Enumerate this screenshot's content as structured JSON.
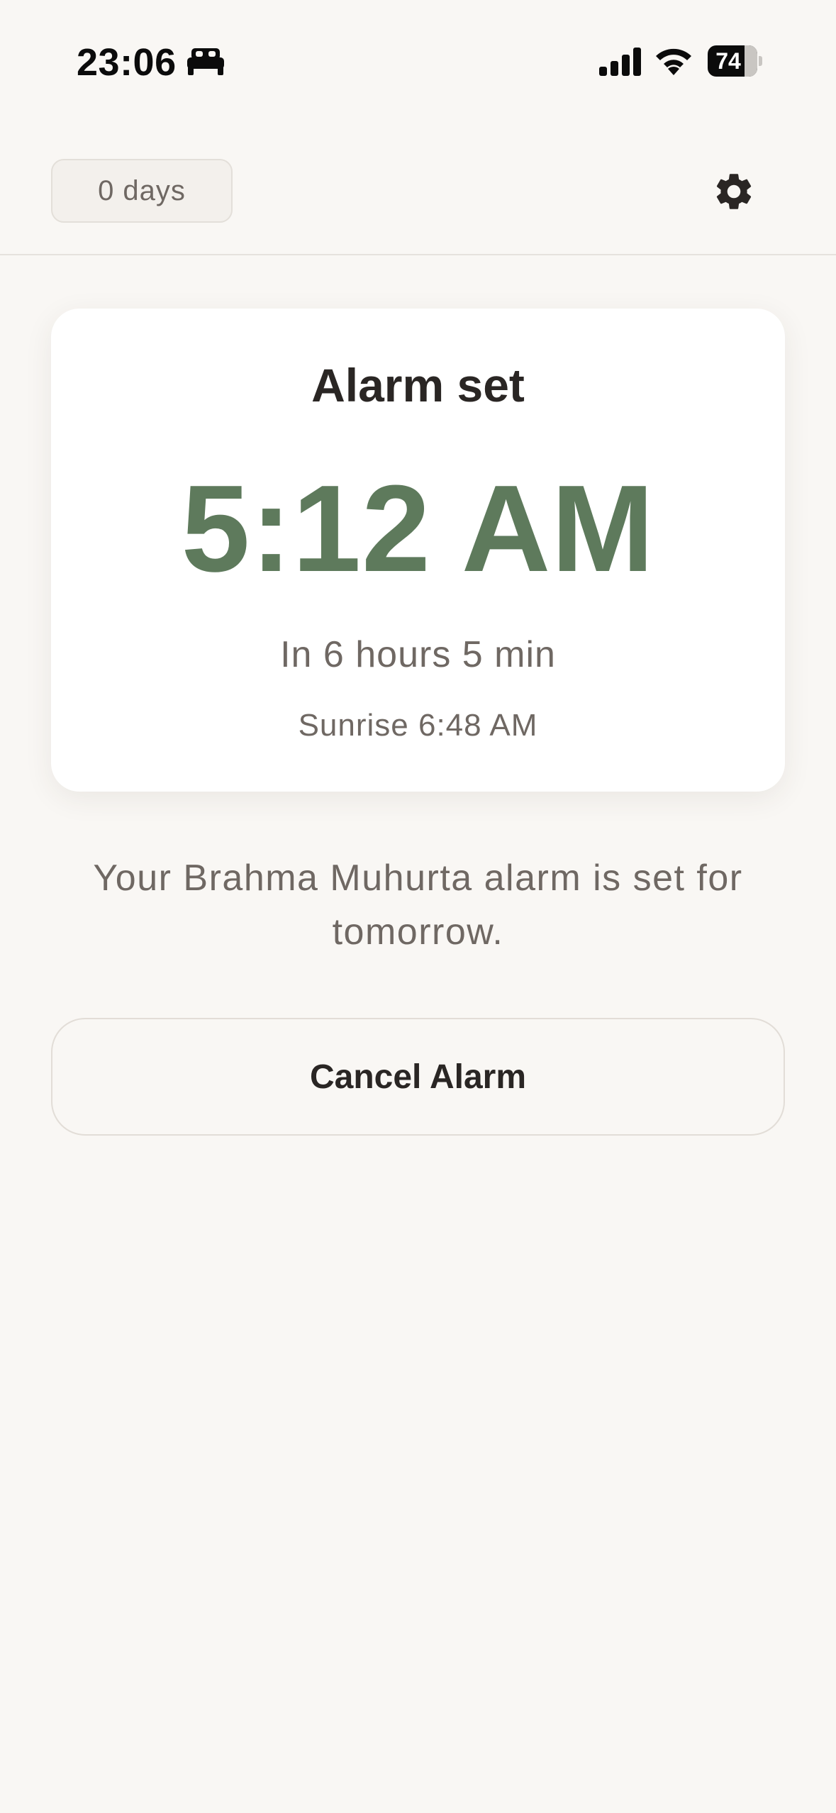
{
  "status_bar": {
    "time": "23:06",
    "battery_percent": 74,
    "battery_label": "74",
    "icons": [
      "bed-icon",
      "signal-icon",
      "wifi-icon",
      "battery-icon"
    ]
  },
  "header": {
    "streak_label": "0 days",
    "settings_icon": "gear-icon"
  },
  "alarm_card": {
    "title": "Alarm set",
    "alarm_time": "5:12 AM",
    "time_remaining": "In 6 hours 5 min",
    "sunrise": "Sunrise 6:48 AM"
  },
  "message": "Your Brahma Muhurta alarm is set for tomorrow.",
  "actions": {
    "cancel_label": "Cancel Alarm"
  },
  "colors": {
    "accent_green": "#5e7a5c",
    "background": "#f9f7f4",
    "text_dark": "#2a2624",
    "text_muted": "#6f6863"
  }
}
